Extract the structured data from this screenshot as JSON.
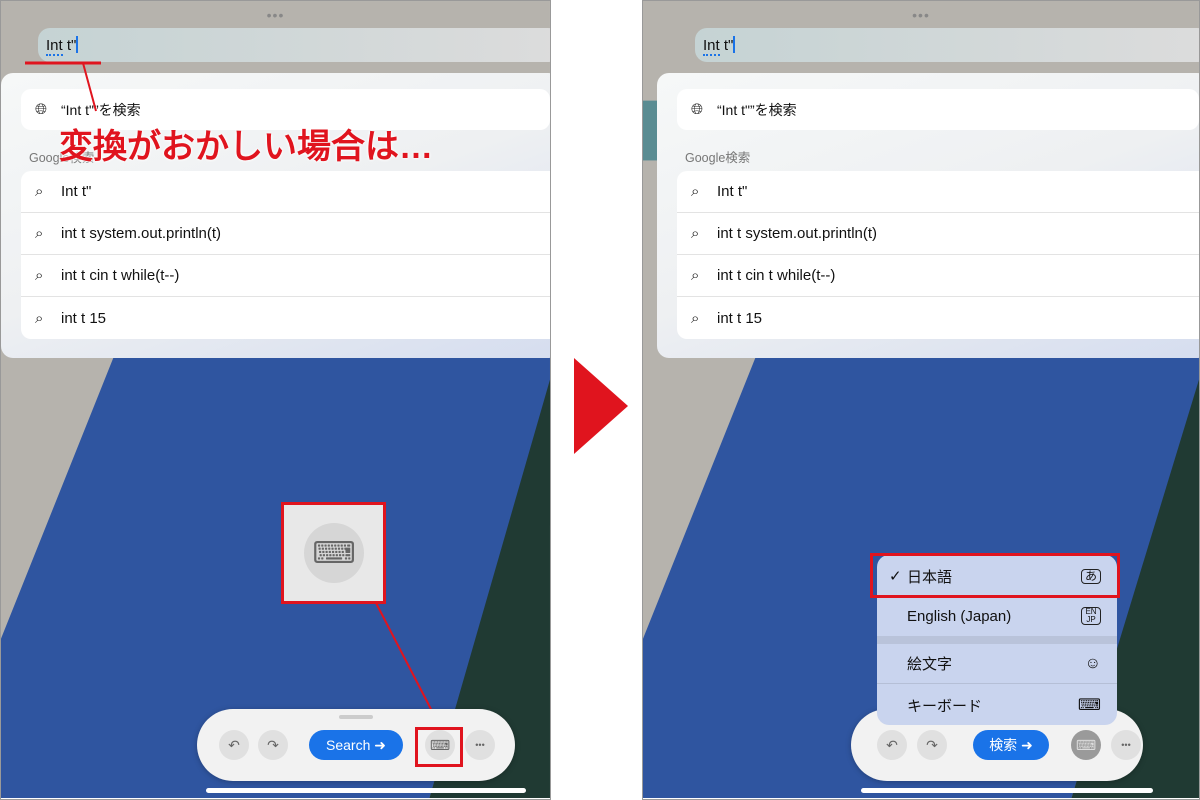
{
  "left": {
    "address_value": "Int t\"",
    "address_underlined": "Int",
    "address_rest": " t\"",
    "web_search": "“Int t\"”を検索",
    "google_label": "Google検索",
    "suggestions": [
      "Int t\"",
      "int t system.out.println(t)",
      "int t cin t while(t--)",
      "int t 15"
    ],
    "annotation": "変換がおかしい場合は…",
    "toolbar": {
      "undo": "↶",
      "redo": "↷",
      "search_label": "Search",
      "more": "•••"
    },
    "keyboard_icon": "⌨"
  },
  "right": {
    "address_underlined": "Int",
    "address_rest": " t\"",
    "web_search": "“Int t\"”を検索",
    "google_label": "Google検索",
    "suggestions": [
      "Int t\"",
      "int t system.out.println(t)",
      "int t cin t while(t--)",
      "int t 15"
    ],
    "menu": [
      {
        "label": "日本語",
        "checked": true,
        "badge": "あ"
      },
      {
        "label": "English (Japan)",
        "checked": false,
        "badge": "EN JP"
      },
      {
        "label": "絵文字",
        "checked": false,
        "badge": "☺"
      },
      {
        "label": "キーボード",
        "checked": false,
        "badge": "⌨"
      }
    ],
    "checkmark": "✓",
    "toolbar": {
      "undo": "↶",
      "redo": "↷",
      "search_label": "検索",
      "more": "•••"
    }
  },
  "colors": {
    "accent": "#1a73e8",
    "annotation": "#e0141e",
    "wallpaper_blue": "#2f55a0",
    "wallpaper_green": "#203a33"
  }
}
